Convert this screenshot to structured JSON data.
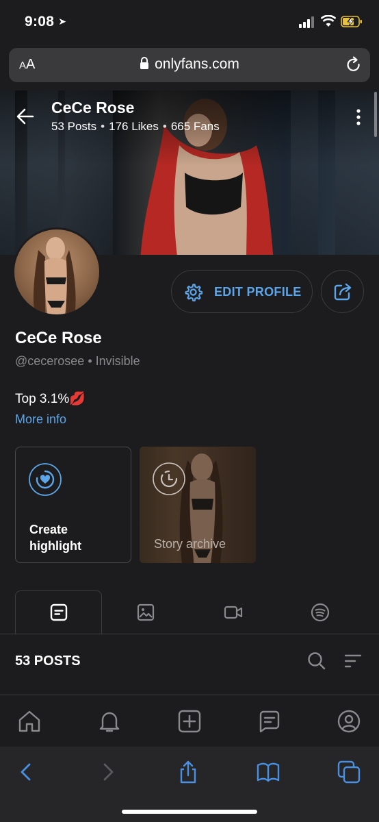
{
  "status": {
    "time": "9:08"
  },
  "browser": {
    "aa_small": "A",
    "aa_big": "A",
    "url": "onlyfans.com"
  },
  "profile": {
    "cover_name": "CeCe Rose",
    "stats": {
      "posts": "53 Posts",
      "likes": "176 Likes",
      "fans": "665 Fans"
    },
    "name": "CeCe Rose",
    "handle": "@cecerosee",
    "presence": "Invisible",
    "bio": "Top 3.1%💋",
    "more_info": "More info",
    "edit_label": "EDIT PROFILE"
  },
  "highlights": {
    "create_line1": "Create",
    "create_line2": "highlight",
    "archive_label": "Story archive"
  },
  "tabs": [
    {
      "icon": "posts-icon",
      "active": true
    },
    {
      "icon": "media-icon",
      "active": false
    },
    {
      "icon": "video-icon",
      "active": false
    },
    {
      "icon": "spotify-icon",
      "active": false
    }
  ],
  "posts_header": {
    "count_label": "53 POSTS"
  },
  "bottom_nav": [
    "home-icon",
    "bell-icon",
    "add-post-icon",
    "messages-icon",
    "profile-icon"
  ],
  "colors": {
    "accent": "#5ca5e8",
    "background": "#1c1c1e",
    "border": "#3c3c3e",
    "muted": "#8a8a8e"
  }
}
